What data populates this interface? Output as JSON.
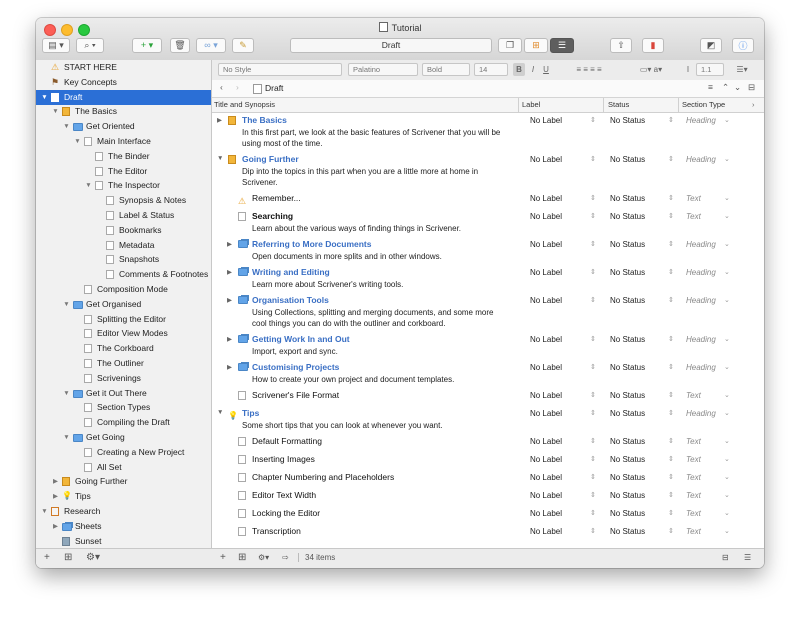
{
  "window": {
    "title": "Tutorial",
    "document_field": "Draft"
  },
  "colors": {
    "selection": "#2b6fd6",
    "link_title": "#3a6fc4",
    "folder": "#62a4e8",
    "book": "#f2b63a"
  },
  "binder": {
    "items": [
      {
        "label": "START HERE",
        "depth": 0,
        "icon": "warning-icon",
        "disclosure": ""
      },
      {
        "label": "Key Concepts",
        "depth": 0,
        "icon": "signpost-icon",
        "disclosure": ""
      },
      {
        "label": "Draft",
        "depth": 0,
        "icon": "draft-icon",
        "disclosure": "▼",
        "selected": true
      },
      {
        "label": "The Basics",
        "depth": 1,
        "icon": "book-icon",
        "disclosure": "▼"
      },
      {
        "label": "Get Oriented",
        "depth": 2,
        "icon": "folder-icon",
        "disclosure": "▼"
      },
      {
        "label": "Main Interface",
        "depth": 3,
        "icon": "document-icon",
        "disclosure": "▼"
      },
      {
        "label": "The Binder",
        "depth": 4,
        "icon": "document-icon",
        "disclosure": ""
      },
      {
        "label": "The Editor",
        "depth": 4,
        "icon": "document-icon",
        "disclosure": ""
      },
      {
        "label": "The Inspector",
        "depth": 4,
        "icon": "document-icon",
        "disclosure": "▼"
      },
      {
        "label": "Synopsis & Notes",
        "depth": 5,
        "icon": "document-icon",
        "disclosure": ""
      },
      {
        "label": "Label & Status",
        "depth": 5,
        "icon": "document-icon",
        "disclosure": ""
      },
      {
        "label": "Bookmarks",
        "depth": 5,
        "icon": "document-icon",
        "disclosure": ""
      },
      {
        "label": "Metadata",
        "depth": 5,
        "icon": "document-icon",
        "disclosure": ""
      },
      {
        "label": "Snapshots",
        "depth": 5,
        "icon": "document-icon",
        "disclosure": ""
      },
      {
        "label": "Comments & Footnotes",
        "depth": 5,
        "icon": "document-icon",
        "disclosure": ""
      },
      {
        "label": "Composition Mode",
        "depth": 3,
        "icon": "document-icon",
        "disclosure": ""
      },
      {
        "label": "Get Organised",
        "depth": 2,
        "icon": "folder-icon",
        "disclosure": "▼"
      },
      {
        "label": "Splitting the Editor",
        "depth": 3,
        "icon": "document-icon",
        "disclosure": ""
      },
      {
        "label": "Editor View Modes",
        "depth": 3,
        "icon": "document-icon",
        "disclosure": ""
      },
      {
        "label": "The Corkboard",
        "depth": 3,
        "icon": "document-icon",
        "disclosure": ""
      },
      {
        "label": "The Outliner",
        "depth": 3,
        "icon": "document-icon",
        "disclosure": ""
      },
      {
        "label": "Scrivenings",
        "depth": 3,
        "icon": "document-icon",
        "disclosure": ""
      },
      {
        "label": "Get it Out There",
        "depth": 2,
        "icon": "folder-icon",
        "disclosure": "▼"
      },
      {
        "label": "Section Types",
        "depth": 3,
        "icon": "document-icon",
        "disclosure": ""
      },
      {
        "label": "Compiling the Draft",
        "depth": 3,
        "icon": "document-icon",
        "disclosure": ""
      },
      {
        "label": "Get Going",
        "depth": 2,
        "icon": "folder-icon",
        "disclosure": "▼"
      },
      {
        "label": "Creating a New Project",
        "depth": 3,
        "icon": "document-icon",
        "disclosure": ""
      },
      {
        "label": "All Set",
        "depth": 3,
        "icon": "document-icon",
        "disclosure": ""
      },
      {
        "label": "Going Further",
        "depth": 1,
        "icon": "book-icon",
        "disclosure": "▶"
      },
      {
        "label": "Tips",
        "depth": 1,
        "icon": "lightbulb-icon",
        "disclosure": "▶"
      },
      {
        "label": "Research",
        "depth": 0,
        "icon": "research-icon",
        "disclosure": "▼"
      },
      {
        "label": "Sheets",
        "depth": 1,
        "icon": "folder-stack-icon",
        "disclosure": "▶"
      },
      {
        "label": "Sunset",
        "depth": 1,
        "icon": "image-icon",
        "disclosure": ""
      }
    ]
  },
  "format_bar": {
    "style": "No Style",
    "font": "Palatino",
    "weight": "Bold",
    "size": "14",
    "bold": "B",
    "italic": "I",
    "underline": "U",
    "line_spacing": "1.1"
  },
  "nav": {
    "document_title": "Draft"
  },
  "outliner": {
    "columns": {
      "title": "Title and Synopsis",
      "label": "Label",
      "status": "Status",
      "section_type": "Section Type"
    },
    "rows": [
      {
        "title": "The Basics",
        "synopsis": "In this first part, we look at the basic features of Scrivener that you will be using most of the time.",
        "label": "No Label",
        "status": "No Status",
        "section_type": "Heading",
        "icon": "book-icon",
        "disclosure": "▶",
        "indent": 0,
        "style": "link"
      },
      {
        "title": "Going Further",
        "synopsis": "Dip into the topics in this part when you are a little more at home in Scrivener.",
        "label": "No Label",
        "status": "No Status",
        "section_type": "Heading",
        "icon": "book-icon",
        "disclosure": "▼",
        "indent": 0,
        "style": "link"
      },
      {
        "title": "Remember...",
        "synopsis": "",
        "label": "No Label",
        "status": "No Status",
        "section_type": "Text",
        "icon": "warning-icon",
        "disclosure": "",
        "indent": 1,
        "style": "plain"
      },
      {
        "title": "Searching",
        "synopsis": "Learn about the various ways of finding things in Scrivener.",
        "label": "No Label",
        "status": "No Status",
        "section_type": "Text",
        "icon": "document-icon",
        "disclosure": "",
        "indent": 1,
        "style": "bold"
      },
      {
        "title": "Referring to More Documents",
        "synopsis": "Open documents in more splits and in other windows.",
        "label": "No Label",
        "status": "No Status",
        "section_type": "Heading",
        "icon": "folder-stack-icon",
        "disclosure": "▶",
        "indent": 1,
        "style": "link"
      },
      {
        "title": "Writing and Editing",
        "synopsis": "Learn more about Scrivener's writing tools.",
        "label": "No Label",
        "status": "No Status",
        "section_type": "Heading",
        "icon": "folder-stack-icon",
        "disclosure": "▶",
        "indent": 1,
        "style": "link"
      },
      {
        "title": "Organisation Tools",
        "synopsis": "Using Collections, splitting and merging documents, and some more cool things you can do with the outliner and corkboard.",
        "label": "No Label",
        "status": "No Status",
        "section_type": "Heading",
        "icon": "folder-stack-icon",
        "disclosure": "▶",
        "indent": 1,
        "style": "link"
      },
      {
        "title": "Getting Work In and Out",
        "synopsis": "Import, export and sync.",
        "label": "No Label",
        "status": "No Status",
        "section_type": "Heading",
        "icon": "folder-stack-icon",
        "disclosure": "▶",
        "indent": 1,
        "style": "link"
      },
      {
        "title": "Customising Projects",
        "synopsis": "How to create your own project and document templates.",
        "label": "No Label",
        "status": "No Status",
        "section_type": "Heading",
        "icon": "folder-stack-icon",
        "disclosure": "▶",
        "indent": 1,
        "style": "link"
      },
      {
        "title": "Scrivener's File Format",
        "synopsis": "",
        "label": "No Label",
        "status": "No Status",
        "section_type": "Text",
        "icon": "document-icon",
        "disclosure": "",
        "indent": 1,
        "style": "plain"
      },
      {
        "title": "Tips",
        "synopsis": "Some short tips that you can look at whenever you want.",
        "label": "No Label",
        "status": "No Status",
        "section_type": "Heading",
        "icon": "lightbulb-icon",
        "disclosure": "▼",
        "indent": 0,
        "style": "link"
      },
      {
        "title": "Default Formatting",
        "synopsis": "",
        "label": "No Label",
        "status": "No Status",
        "section_type": "Text",
        "icon": "document-icon",
        "disclosure": "",
        "indent": 1,
        "style": "plain"
      },
      {
        "title": "Inserting Images",
        "synopsis": "",
        "label": "No Label",
        "status": "No Status",
        "section_type": "Text",
        "icon": "document-icon",
        "disclosure": "",
        "indent": 1,
        "style": "plain"
      },
      {
        "title": "Chapter Numbering and Placeholders",
        "synopsis": "",
        "label": "No Label",
        "status": "No Status",
        "section_type": "Text",
        "icon": "document-icon",
        "disclosure": "",
        "indent": 1,
        "style": "plain"
      },
      {
        "title": "Editor Text Width",
        "synopsis": "",
        "label": "No Label",
        "status": "No Status",
        "section_type": "Text",
        "icon": "document-icon",
        "disclosure": "",
        "indent": 1,
        "style": "plain"
      },
      {
        "title": "Locking the Editor",
        "synopsis": "",
        "label": "No Label",
        "status": "No Status",
        "section_type": "Text",
        "icon": "document-icon",
        "disclosure": "",
        "indent": 1,
        "style": "plain"
      },
      {
        "title": "Transcription",
        "synopsis": "",
        "label": "No Label",
        "status": "No Status",
        "section_type": "Text",
        "icon": "document-icon",
        "disclosure": "",
        "indent": 1,
        "style": "plain"
      }
    ]
  },
  "footer": {
    "item_count": "34 items"
  }
}
